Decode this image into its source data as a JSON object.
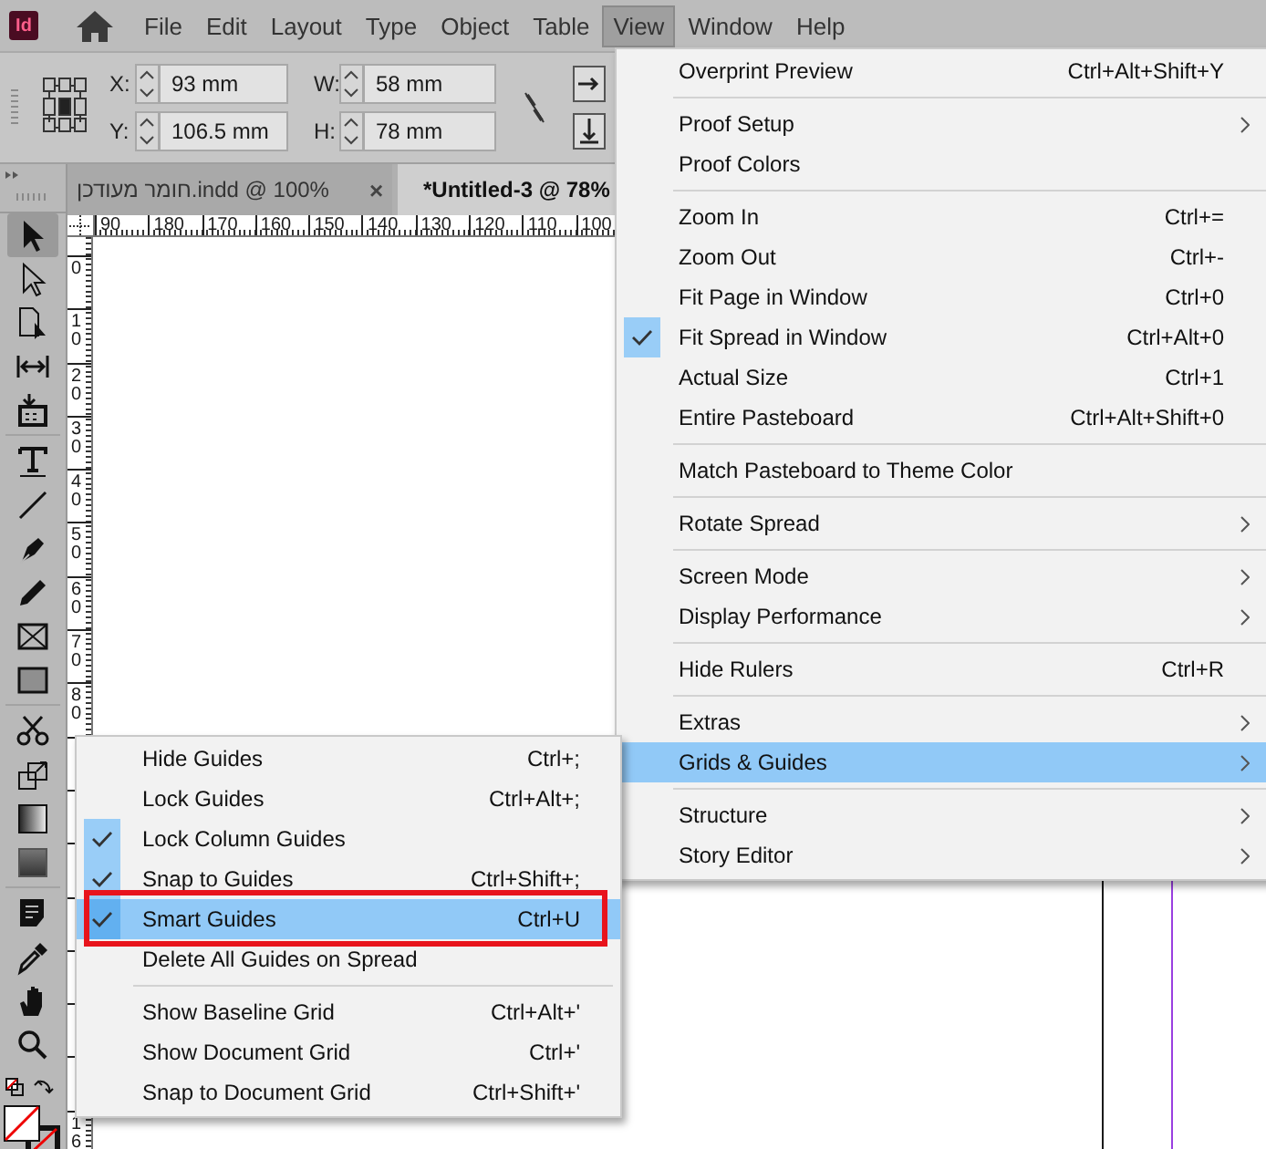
{
  "app": {
    "logo": "Id"
  },
  "menu_bar": [
    {
      "label": "File",
      "selected": false
    },
    {
      "label": "Edit",
      "selected": false
    },
    {
      "label": "Layout",
      "selected": false
    },
    {
      "label": "Type",
      "selected": false
    },
    {
      "label": "Object",
      "selected": false
    },
    {
      "label": "Table",
      "selected": false
    },
    {
      "label": "View",
      "selected": true
    },
    {
      "label": "Window",
      "selected": false
    },
    {
      "label": "Help",
      "selected": false
    }
  ],
  "control_panel": {
    "fields": [
      {
        "label": "X:",
        "value": "93 mm"
      },
      {
        "label": "Y:",
        "value": "106.5 mm"
      },
      {
        "label": "W:",
        "value": "58 mm"
      },
      {
        "label": "H:",
        "value": "78 mm"
      }
    ]
  },
  "document_tabs": [
    {
      "label": "חומר מעודכן.indd @ 100%",
      "close": "×",
      "selected": false
    },
    {
      "label": "*Untitled-3 @ 78%",
      "selected": true
    }
  ],
  "tools": [
    {
      "selected": true
    },
    {
      "selected": false
    },
    {
      "selected": false
    },
    {
      "selected": false
    },
    {
      "selected": false
    },
    {
      "selected": false
    },
    {
      "selected": false
    },
    {
      "selected": false
    },
    {
      "selected": false
    },
    {
      "selected": false
    },
    {
      "selected": false
    },
    {
      "selected": false
    },
    {
      "selected": false
    },
    {
      "selected": false
    },
    {
      "selected": false
    },
    {
      "selected": false
    },
    {
      "selected": false
    },
    {
      "selected": false
    },
    {
      "selected": false
    }
  ],
  "ruler_h": [
    "90",
    "180",
    "170",
    "160",
    "150",
    "140",
    "130",
    "120",
    "110",
    "100"
  ],
  "ruler_v": [
    "0",
    "10",
    "20",
    "30",
    "40",
    "50",
    "60",
    "70",
    "80",
    "16"
  ],
  "view_menu": {
    "items": [
      {
        "kind": "item",
        "label": "Overprint Preview",
        "shortcut": "Ctrl+Alt+Shift+Y",
        "checked": false,
        "has_submenu": false,
        "selected": false
      },
      {
        "kind": "separator"
      },
      {
        "kind": "item",
        "label": "Proof Setup",
        "checked": false,
        "has_submenu": true,
        "selected": false
      },
      {
        "kind": "item",
        "label": "Proof Colors",
        "checked": false,
        "has_submenu": false,
        "selected": false
      },
      {
        "kind": "separator"
      },
      {
        "kind": "item",
        "label": "Zoom In",
        "shortcut": "Ctrl+=",
        "checked": false,
        "has_submenu": false,
        "selected": false
      },
      {
        "kind": "item",
        "label": "Zoom Out",
        "shortcut": "Ctrl+-",
        "checked": false,
        "has_submenu": false,
        "selected": false
      },
      {
        "kind": "item",
        "label": "Fit Page in Window",
        "shortcut": "Ctrl+0",
        "checked": false,
        "has_submenu": false,
        "selected": false
      },
      {
        "kind": "item",
        "label": "Fit Spread in Window",
        "shortcut": "Ctrl+Alt+0",
        "checked": true,
        "has_submenu": false,
        "selected": false
      },
      {
        "kind": "item",
        "label": "Actual Size",
        "shortcut": "Ctrl+1",
        "checked": false,
        "has_submenu": false,
        "selected": false
      },
      {
        "kind": "item",
        "label": "Entire Pasteboard",
        "shortcut": "Ctrl+Alt+Shift+0",
        "checked": false,
        "has_submenu": false,
        "selected": false
      },
      {
        "kind": "separator"
      },
      {
        "kind": "item",
        "label": "Match Pasteboard to Theme Color",
        "checked": false,
        "has_submenu": false,
        "selected": false
      },
      {
        "kind": "separator"
      },
      {
        "kind": "item",
        "label": "Rotate Spread",
        "checked": false,
        "has_submenu": true,
        "selected": false
      },
      {
        "kind": "separator"
      },
      {
        "kind": "item",
        "label": "Screen Mode",
        "checked": false,
        "has_submenu": true,
        "selected": false
      },
      {
        "kind": "item",
        "label": "Display Performance",
        "checked": false,
        "has_submenu": true,
        "selected": false
      },
      {
        "kind": "separator"
      },
      {
        "kind": "item",
        "label": "Hide Rulers",
        "shortcut": "Ctrl+R",
        "checked": false,
        "has_submenu": false,
        "selected": false
      },
      {
        "kind": "separator"
      },
      {
        "kind": "item",
        "label": "Extras",
        "checked": false,
        "has_submenu": true,
        "selected": false
      },
      {
        "kind": "item",
        "label": "Grids & Guides",
        "checked": false,
        "has_submenu": true,
        "selected": true
      },
      {
        "kind": "separator"
      },
      {
        "kind": "item",
        "label": "Structure",
        "checked": false,
        "has_submenu": true,
        "selected": false
      },
      {
        "kind": "item",
        "label": "Story Editor",
        "checked": false,
        "has_submenu": true,
        "selected": false
      }
    ]
  },
  "guides_submenu": {
    "items": [
      {
        "kind": "item",
        "label": "Hide Guides",
        "shortcut": "Ctrl+;",
        "checked": false,
        "selected": false,
        "outlined": false
      },
      {
        "kind": "item",
        "label": "Lock Guides",
        "shortcut": "Ctrl+Alt+;",
        "checked": false,
        "selected": false,
        "outlined": false
      },
      {
        "kind": "item",
        "label": "Lock Column Guides",
        "checked": true,
        "selected": false,
        "outlined": false
      },
      {
        "kind": "item",
        "label": "Snap to Guides",
        "shortcut": "Ctrl+Shift+;",
        "checked": true,
        "selected": false,
        "outlined": false
      },
      {
        "kind": "item",
        "label": "Smart Guides",
        "shortcut": "Ctrl+U",
        "checked": true,
        "selected": true,
        "outlined": true
      },
      {
        "kind": "item",
        "label": "Delete All Guides on Spread",
        "checked": false,
        "selected": false,
        "outlined": false
      },
      {
        "kind": "separator"
      },
      {
        "kind": "item",
        "label": "Show Baseline Grid",
        "shortcut": "Ctrl+Alt+'",
        "checked": false,
        "selected": false,
        "outlined": false
      },
      {
        "kind": "item",
        "label": "Show Document Grid",
        "shortcut": "Ctrl+'",
        "checked": false,
        "selected": false,
        "outlined": false
      },
      {
        "kind": "item",
        "label": "Snap to Document Grid",
        "shortcut": "Ctrl+Shift+'",
        "checked": false,
        "selected": false,
        "outlined": false
      }
    ]
  }
}
